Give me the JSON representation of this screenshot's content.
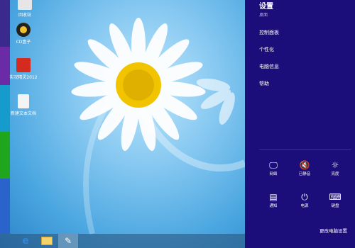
{
  "desktop_icons": [
    {
      "name": "recycle-bin-icon",
      "label": "回收站",
      "color": "#e6e6e6"
    },
    {
      "name": "cd-app-icon",
      "label": "CD盒子",
      "color": "#f2c22e"
    },
    {
      "name": "game-app-icon",
      "label": "实况精灵2012",
      "color": "#d42a1f"
    },
    {
      "name": "text-file-icon",
      "label": "新建文本文档",
      "color": "#f4f4f4"
    }
  ],
  "taskbar": {
    "items": [
      {
        "name": "ie-button",
        "icon": "internet-explorer-icon",
        "glyph": "e"
      },
      {
        "name": "explorer-button",
        "icon": "folder-icon",
        "glyph": "▭"
      },
      {
        "name": "paint-button",
        "icon": "paint-icon",
        "glyph": "✎"
      }
    ]
  },
  "settings": {
    "title": "设置",
    "subtitle": "桌面",
    "menu": [
      "控制面板",
      "个性化",
      "电脑信息",
      "帮助"
    ],
    "quick": [
      {
        "label": "网络",
        "icon": "network-icon",
        "glyph": "🖵"
      },
      {
        "label": "已静音",
        "icon": "mute-icon",
        "glyph": "🔇"
      },
      {
        "label": "亮度",
        "icon": "brightness-icon",
        "glyph": "☼"
      },
      {
        "label": "通知",
        "icon": "notification-icon",
        "glyph": "▤"
      },
      {
        "label": "电源",
        "icon": "power-icon",
        "glyph": "⏻"
      },
      {
        "label": "键盘",
        "icon": "keyboard-icon",
        "glyph": "⌨"
      }
    ],
    "change_pc": "更改电脑设置"
  },
  "colors": {
    "charm_bg": "#1b0d7a",
    "accent": "#2f86d8"
  }
}
